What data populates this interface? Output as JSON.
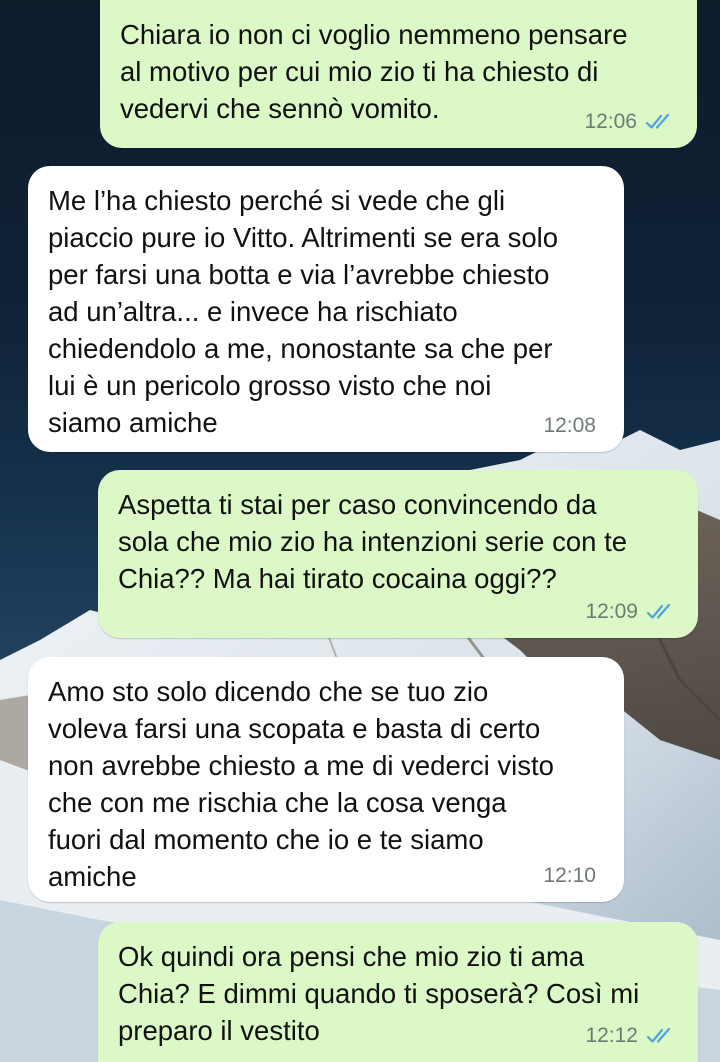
{
  "messages": [
    {
      "direction": "outgoing",
      "text": "Chiara io non ci voglio nemmeno pensare\nal motivo per cui mio zio ti ha chiesto di\nvedervi che sennò vomito.",
      "time": "12:06",
      "status": "read"
    },
    {
      "direction": "incoming",
      "text": "Me l’ha chiesto perché si vede che gli\npiaccio pure io Vitto. Altrimenti se era solo\nper farsi una botta e via l’avrebbe chiesto\nad un’altra... e invece ha rischiato\nchiedendolo a me, nonostante sa che per\nlui è un pericolo grosso visto che noi\nsiamo amiche",
      "time": "12:08"
    },
    {
      "direction": "outgoing",
      "text": "Aspetta ti stai per caso convincendo da\nsola che mio zio ha intenzioni serie con te\nChia?? Ma hai tirato cocaina oggi??",
      "time": "12:09",
      "status": "read"
    },
    {
      "direction": "incoming",
      "text": "Amo sto solo dicendo che se tuo zio\nvoleva farsi una scopata e basta di certo\nnon avrebbe chiesto a me di vederci visto\nche con me rischia che la cosa venga\nfuori dal momento che io e te siamo\namiche",
      "time": "12:10"
    },
    {
      "direction": "outgoing",
      "text": "Ok quindi ora pensi che mio zio ti ama\nChia? E dimmi quando ti sposerà? Così mi\npreparo il vestito",
      "time": "12:12",
      "status": "read"
    }
  ],
  "colors": {
    "outgoing_bubble": "#dcf8c6",
    "incoming_bubble": "#ffffff",
    "read_ticks": "#4fa3e0",
    "time_text": "#6f7b72"
  },
  "icons": {
    "read_receipt": "double-check-icon"
  }
}
